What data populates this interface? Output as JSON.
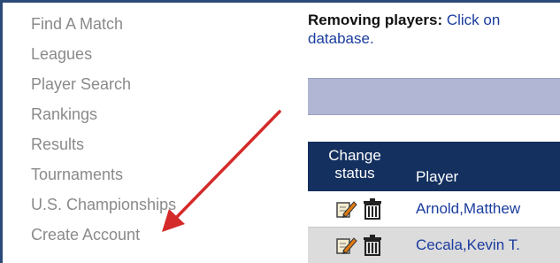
{
  "sidebar": {
    "items": [
      {
        "label": "Find A Match"
      },
      {
        "label": "Leagues"
      },
      {
        "label": "Player Search"
      },
      {
        "label": "Rankings"
      },
      {
        "label": "Results"
      },
      {
        "label": "Tournaments"
      },
      {
        "label": "U.S. Championships"
      },
      {
        "label": "Create Account"
      }
    ]
  },
  "main": {
    "instructions": {
      "bold": "Removing players:",
      "text": " Click on",
      "line2": "database."
    },
    "table": {
      "header": {
        "change_line1": "Change",
        "change_line2": "status",
        "player": "Player"
      },
      "rows": [
        {
          "player": "Arnold,Matthew"
        },
        {
          "player": "Cecala,Kevin T."
        }
      ]
    }
  },
  "annotation": {
    "arrow_color": "#d42a2a"
  },
  "colors": {
    "nav_text": "#8a8a8a",
    "link": "#1a3c9e",
    "header_bg": "#14305f",
    "filter_bar": "#b0b6d3",
    "row_alt": "#dcdcdc",
    "border": "#2b4a78"
  }
}
